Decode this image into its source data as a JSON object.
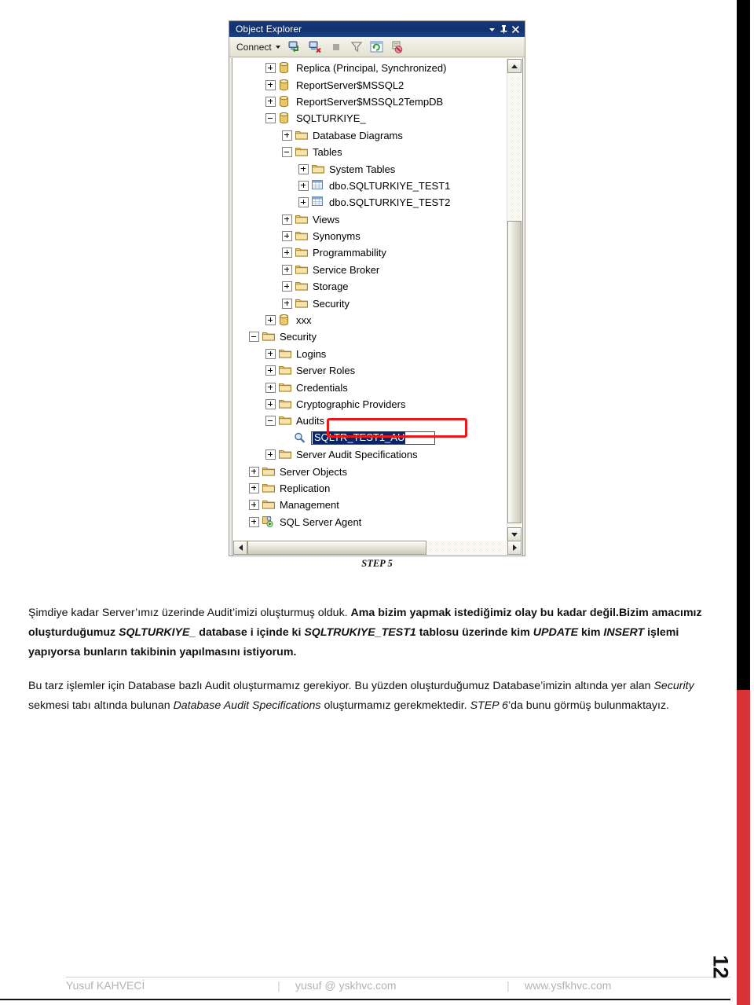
{
  "document": {
    "page_number": "12",
    "step_caption": "STEP 5"
  },
  "object_explorer": {
    "title": "Object Explorer",
    "titlebar_buttons": [
      {
        "name": "window-menu-icon",
        "glyph": "▾"
      },
      {
        "name": "pin-icon",
        "glyph": "⇱"
      },
      {
        "name": "close-icon",
        "glyph": "✕"
      }
    ],
    "toolbar": {
      "connect_label": "Connect",
      "icons": [
        "connect-object-explorer-icon",
        "disconnect-object-explorer-icon",
        "stop-icon",
        "filter-icon",
        "refresh-icon",
        "script-icon"
      ]
    },
    "tree": [
      {
        "indent": 2,
        "state": "plus",
        "icon": "database-icon",
        "label": "Replica (Principal, Synchronized)"
      },
      {
        "indent": 2,
        "state": "plus",
        "icon": "database-icon",
        "label": "ReportServer$MSSQL2"
      },
      {
        "indent": 2,
        "state": "plus",
        "icon": "database-icon",
        "label": "ReportServer$MSSQL2TempDB"
      },
      {
        "indent": 2,
        "state": "minus",
        "icon": "database-icon",
        "label": "SQLTURKIYE_"
      },
      {
        "indent": 3,
        "state": "plus",
        "icon": "folder-icon",
        "label": "Database Diagrams"
      },
      {
        "indent": 3,
        "state": "minus",
        "icon": "folder-icon",
        "label": "Tables"
      },
      {
        "indent": 4,
        "state": "plus",
        "icon": "folder-icon",
        "label": "System Tables"
      },
      {
        "indent": 4,
        "state": "plus",
        "icon": "table-icon",
        "label": "dbo.SQLTURKIYE_TEST1"
      },
      {
        "indent": 4,
        "state": "plus",
        "icon": "table-icon",
        "label": "dbo.SQLTURKIYE_TEST2"
      },
      {
        "indent": 3,
        "state": "plus",
        "icon": "folder-icon",
        "label": "Views"
      },
      {
        "indent": 3,
        "state": "plus",
        "icon": "folder-icon",
        "label": "Synonyms"
      },
      {
        "indent": 3,
        "state": "plus",
        "icon": "folder-icon",
        "label": "Programmability"
      },
      {
        "indent": 3,
        "state": "plus",
        "icon": "folder-icon",
        "label": "Service Broker"
      },
      {
        "indent": 3,
        "state": "plus",
        "icon": "folder-icon",
        "label": "Storage"
      },
      {
        "indent": 3,
        "state": "plus",
        "icon": "folder-icon",
        "label": "Security"
      },
      {
        "indent": 2,
        "state": "plus",
        "icon": "database-icon",
        "label": "xxx"
      },
      {
        "indent": 1,
        "state": "minus",
        "icon": "folder-icon",
        "label": "Security"
      },
      {
        "indent": 2,
        "state": "plus",
        "icon": "folder-icon",
        "label": "Logins"
      },
      {
        "indent": 2,
        "state": "plus",
        "icon": "folder-icon",
        "label": "Server Roles"
      },
      {
        "indent": 2,
        "state": "plus",
        "icon": "folder-icon",
        "label": "Credentials"
      },
      {
        "indent": 2,
        "state": "plus",
        "icon": "folder-icon",
        "label": "Cryptographic Providers"
      },
      {
        "indent": 2,
        "state": "minus",
        "icon": "folder-icon",
        "label": "Audits"
      },
      {
        "indent": 3,
        "state": "none",
        "icon": "audit-icon",
        "label": "SQLTR_TEST1_AU",
        "editing": true
      },
      {
        "indent": 2,
        "state": "plus",
        "icon": "folder-icon",
        "label": "Server Audit Specifications"
      },
      {
        "indent": 1,
        "state": "plus",
        "icon": "folder-icon",
        "label": "Server Objects"
      },
      {
        "indent": 1,
        "state": "plus",
        "icon": "folder-icon",
        "label": "Replication"
      },
      {
        "indent": 1,
        "state": "plus",
        "icon": "folder-icon",
        "label": "Management"
      },
      {
        "indent": 1,
        "state": "plus",
        "icon": "agent-icon",
        "label": "SQL Server Agent"
      }
    ],
    "annotation_color": "#e8191b"
  },
  "prose": {
    "p1": [
      {
        "t": "Şimdiye kadar Server’ımız üzerinde Audit’imizi oluşturmuş olduk. ",
        "style": "normal"
      },
      {
        "t": "Ama bizim yapmak istediğimiz olay bu kadar değil.",
        "style": "bold"
      },
      {
        "t": "Bizim amacımız oluşturduğumuz ",
        "style": "bold"
      },
      {
        "t": "SQLTURKIYE_",
        "style": "bold-italic"
      },
      {
        "t": " database i içinde ki ",
        "style": "bold"
      },
      {
        "t": "SQLTRUKIYE_TEST1",
        "style": "bold-italic"
      },
      {
        "t": " tablosu üzerinde kim ",
        "style": "bold"
      },
      {
        "t": "UPDATE",
        "style": "bold-italic"
      },
      {
        "t": " kim ",
        "style": "bold"
      },
      {
        "t": "INSERT",
        "style": "bold-italic"
      },
      {
        "t": " işlemi yapıyorsa bunların takibinin yapılmasını istiyorum.",
        "style": "bold"
      }
    ],
    "p2": [
      {
        "t": "Bu tarz işlemler için Database bazlı Audit oluşturmamız gerekiyor. Bu yüzden oluşturduğumuz Database’imizin altında yer alan ",
        "style": "normal"
      },
      {
        "t": "Security",
        "style": "italic"
      },
      {
        "t": " sekmesi tabı altında bulunan ",
        "style": "normal"
      },
      {
        "t": "Database Audit Specifications",
        "style": "italic"
      },
      {
        "t": " oluşturmamız gerekmektedir. ",
        "style": "normal"
      },
      {
        "t": "STEP 6",
        "style": "italic"
      },
      {
        "t": "’da bunu görmüş bulunmaktayız.",
        "style": "normal"
      }
    ]
  },
  "footer": {
    "author": "Yusuf KAHVECİ",
    "sep1": "|",
    "email": "yusuf @ yskhvc.com",
    "sep2": "|",
    "website": "www.ysfkhvc.com"
  }
}
